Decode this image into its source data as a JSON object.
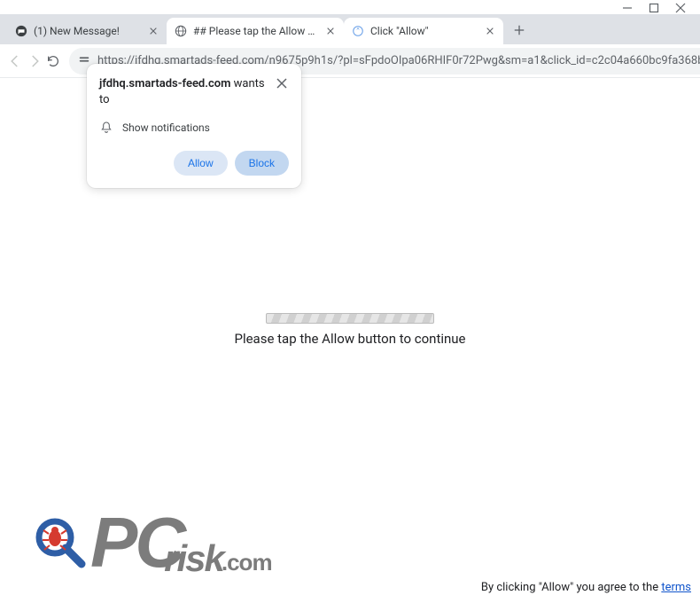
{
  "tabs": [
    {
      "title": "(1) New Message!"
    },
    {
      "title": "## Please tap the Allow button"
    },
    {
      "title": "Click \"Allow\""
    }
  ],
  "url": "https://jfdhq.smartads-feed.com/n9675p9h1s/?pl=sFpdoOIpa06RHIF0r72Pwg&sm=a1&click_id=c2c04a660bc9fa368b25...",
  "popup": {
    "domain": "jfdhq.smartads-feed.com",
    "wants_to": "wants to",
    "permission": "Show notifications",
    "allow_label": "Allow",
    "block_label": "Block"
  },
  "content": {
    "message": "Please tap the Allow button to continue"
  },
  "watermark": {
    "pc": "PC",
    "risk": "risk",
    "com": ".com"
  },
  "footer": {
    "prefix": "By clicking \"Allow\" you agree to the ",
    "link": "terms"
  }
}
